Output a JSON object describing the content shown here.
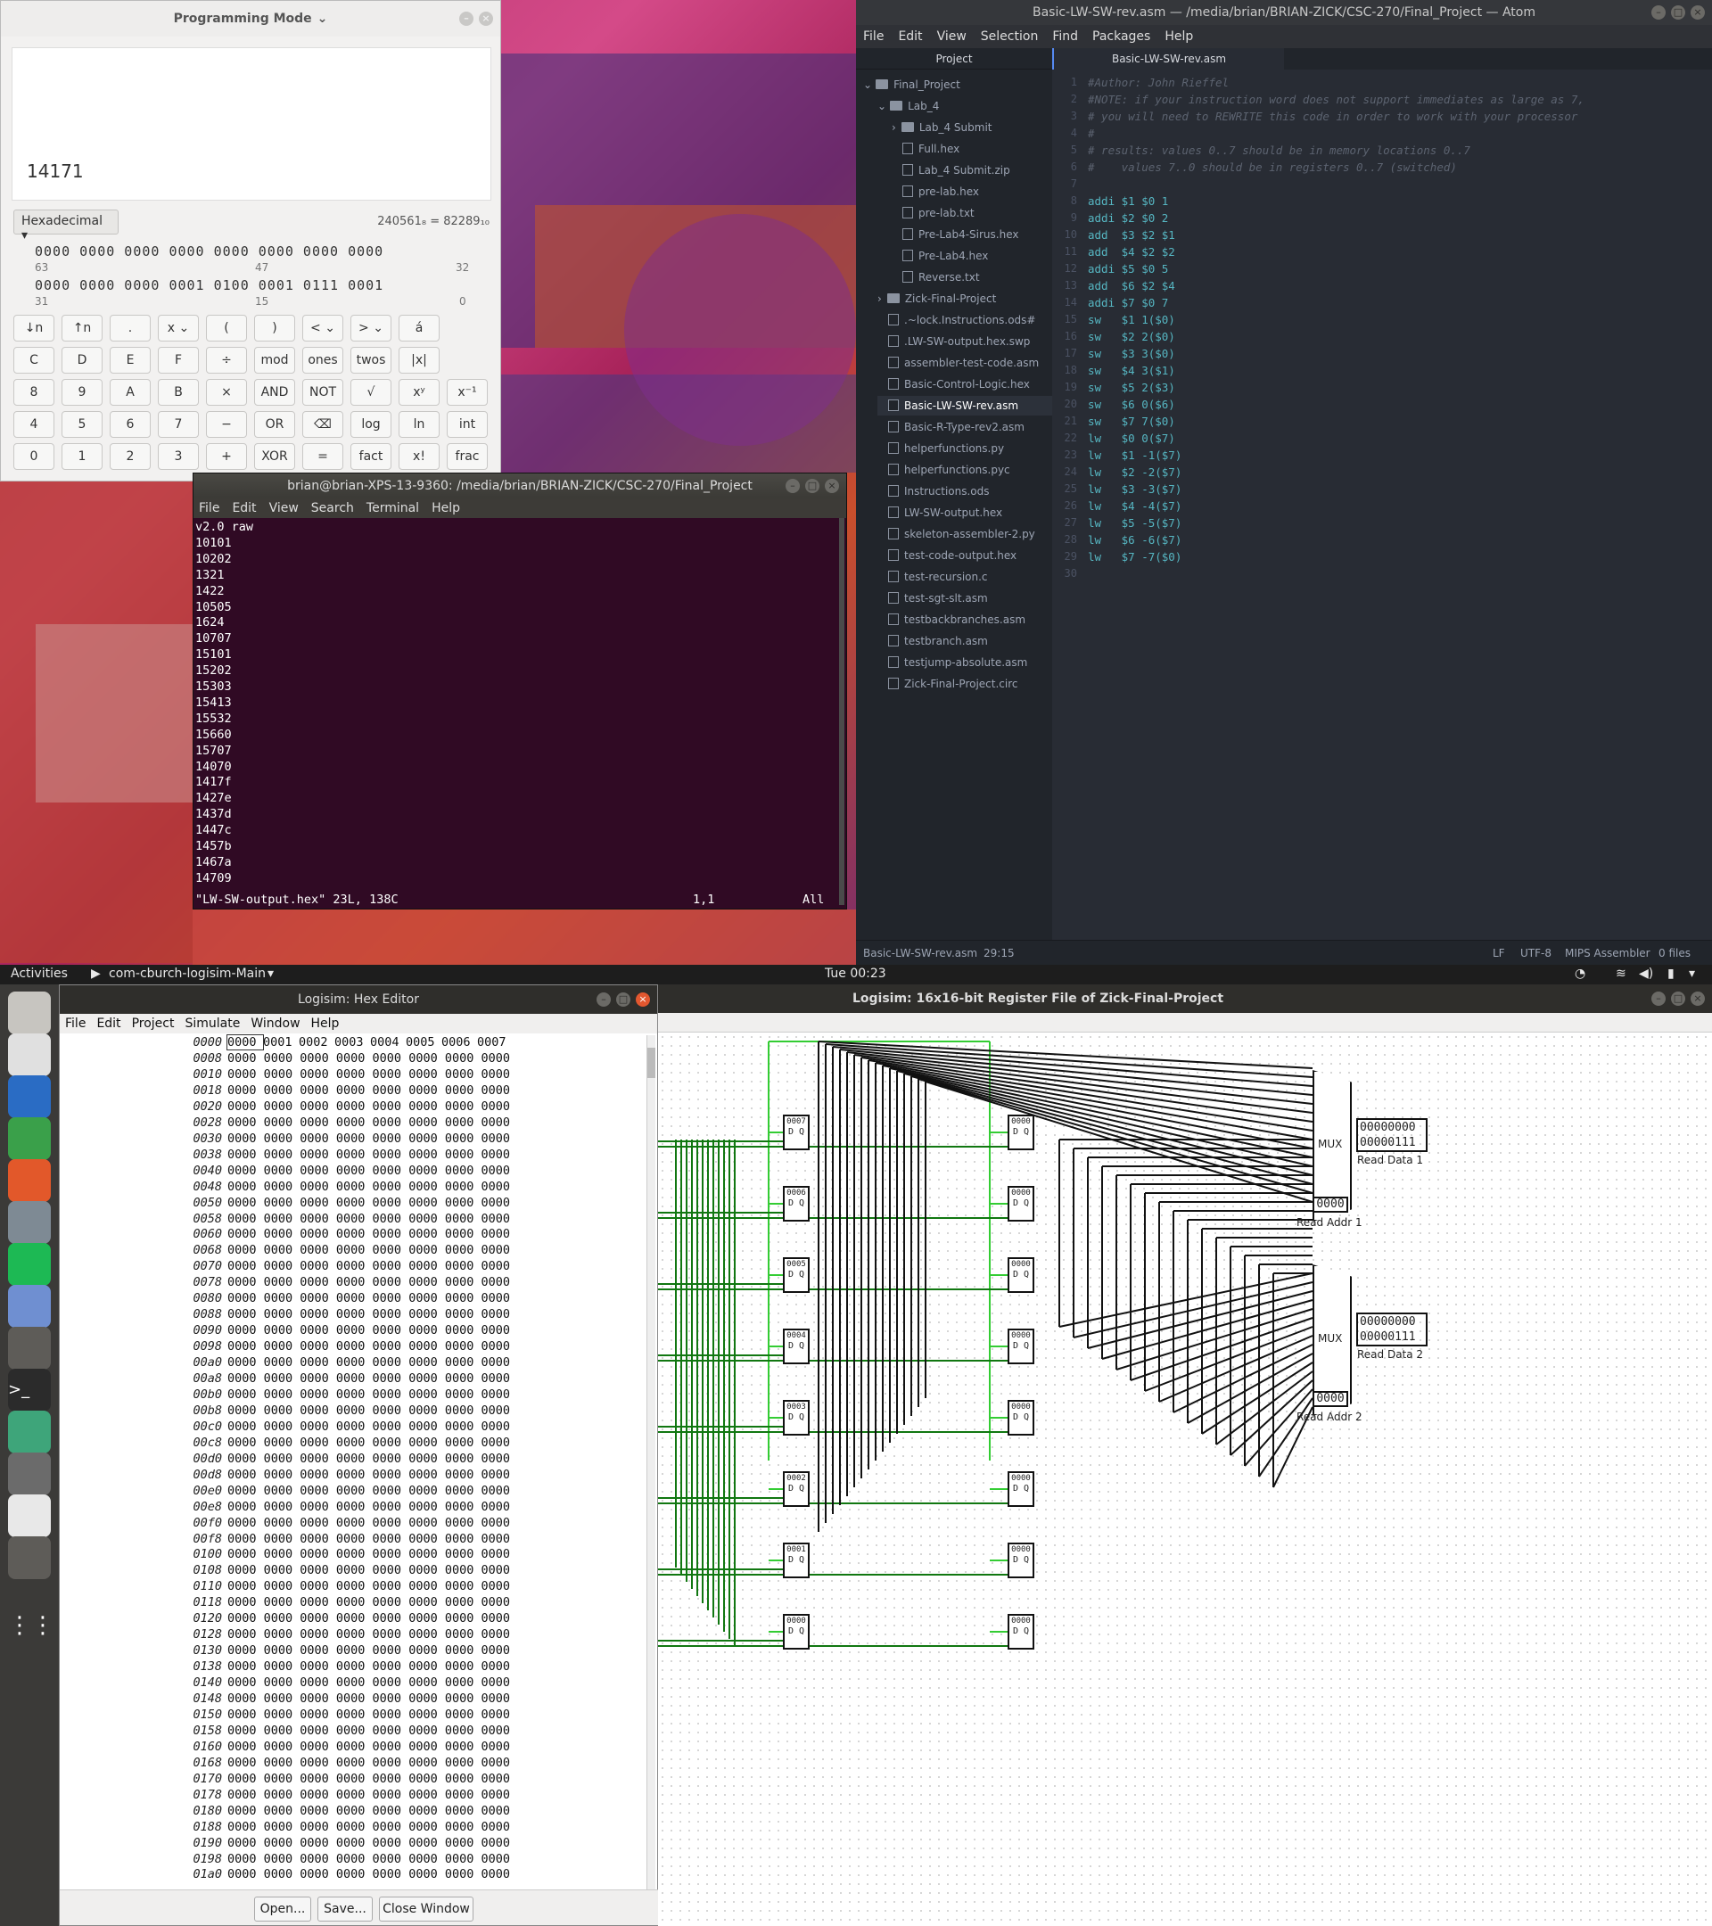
{
  "calculator": {
    "title": "Programming Mode",
    "value": "14171",
    "base": "Hexadecimal",
    "conversion": "240561₈ = 82289₁₀",
    "bits_row1": "0000 0000 0000 0000 0000 0000 0000 0000",
    "bits_row1_idx": [
      "63",
      "47",
      "32"
    ],
    "bits_row2": "0000 0000 0000 0001 0100 0001 0111 0001",
    "bits_row2_idx": [
      "31",
      "15",
      "0"
    ],
    "buttons": [
      [
        "↓n",
        "↑n",
        ".",
        "x ⌄",
        "(",
        ")",
        "< ⌄",
        "> ⌄",
        "á"
      ],
      [
        "C",
        "D",
        "E",
        "F",
        "÷",
        "mod",
        "ones",
        "twos",
        "|x|"
      ],
      [
        "8",
        "9",
        "A",
        "B",
        "×",
        "AND",
        "NOT",
        "√",
        "xʸ",
        "x⁻¹"
      ],
      [
        "4",
        "5",
        "6",
        "7",
        "−",
        "OR",
        "⌫",
        "log",
        "ln",
        "int"
      ],
      [
        "0",
        "1",
        "2",
        "3",
        "+",
        "XOR",
        "=",
        "fact",
        "x!",
        "frac"
      ]
    ]
  },
  "atom": {
    "title": "Basic-LW-SW-rev.asm — /media/brian/BRIAN-ZICK/CSC-270/Final_Project — Atom",
    "menu": [
      "File",
      "Edit",
      "View",
      "Selection",
      "Find",
      "Packages",
      "Help"
    ],
    "project_tab": "Project",
    "file_tab": "Basic-LW-SW-rev.asm",
    "tree": [
      {
        "label": "Final_Project",
        "type": "folder-open",
        "depth": 0
      },
      {
        "label": "Lab_4",
        "type": "folder-open",
        "depth": 1
      },
      {
        "label": "Lab_4 Submit",
        "type": "folder",
        "depth": 2
      },
      {
        "label": "Full.hex",
        "type": "file",
        "depth": 2
      },
      {
        "label": "Lab_4 Submit.zip",
        "type": "file",
        "depth": 2
      },
      {
        "label": "pre-lab.hex",
        "type": "file",
        "depth": 2
      },
      {
        "label": "pre-lab.txt",
        "type": "file",
        "depth": 2
      },
      {
        "label": "Pre-Lab4-Sirus.hex",
        "type": "file",
        "depth": 2
      },
      {
        "label": "Pre-Lab4.hex",
        "type": "file",
        "depth": 2
      },
      {
        "label": "Reverse.txt",
        "type": "file",
        "depth": 2
      },
      {
        "label": "Zick-Final-Project",
        "type": "folder",
        "depth": 1
      },
      {
        "label": ".~lock.Instructions.ods#",
        "type": "file",
        "depth": 1
      },
      {
        "label": ".LW-SW-output.hex.swp",
        "type": "file",
        "depth": 1
      },
      {
        "label": "assembler-test-code.asm",
        "type": "file",
        "depth": 1
      },
      {
        "label": "Basic-Control-Logic.hex",
        "type": "file",
        "depth": 1
      },
      {
        "label": "Basic-LW-SW-rev.asm",
        "type": "file",
        "depth": 1,
        "selected": true
      },
      {
        "label": "Basic-R-Type-rev2.asm",
        "type": "file",
        "depth": 1
      },
      {
        "label": "helperfunctions.py",
        "type": "file",
        "depth": 1
      },
      {
        "label": "helperfunctions.pyc",
        "type": "file",
        "depth": 1
      },
      {
        "label": "Instructions.ods",
        "type": "file",
        "depth": 1
      },
      {
        "label": "LW-SW-output.hex",
        "type": "file",
        "depth": 1
      },
      {
        "label": "skeleton-assembler-2.py",
        "type": "file",
        "depth": 1
      },
      {
        "label": "test-code-output.hex",
        "type": "file",
        "depth": 1
      },
      {
        "label": "test-recursion.c",
        "type": "file",
        "depth": 1
      },
      {
        "label": "test-sgt-slt.asm",
        "type": "file",
        "depth": 1
      },
      {
        "label": "testbackbranches.asm",
        "type": "file",
        "depth": 1
      },
      {
        "label": "testbranch.asm",
        "type": "file",
        "depth": 1
      },
      {
        "label": "testjump-absolute.asm",
        "type": "file",
        "depth": 1
      },
      {
        "label": "Zick-Final-Project.circ",
        "type": "file",
        "depth": 1
      }
    ],
    "code": [
      "#Author: John Rieffel",
      "#NOTE: if your instruction word does not support immediates as large as 7,",
      "# you will need to REWRITE this code in order to work with your processor",
      "#",
      "# results: values 0..7 should be in memory locations 0..7",
      "#    values 7..0 should be in registers 0..7 (switched)",
      "",
      "addi $1 $0 1",
      "addi $2 $0 2",
      "add  $3 $2 $1",
      "add  $4 $2 $2",
      "addi $5 $0 5",
      "add  $6 $2 $4",
      "addi $7 $0 7",
      "sw   $1 1($0)",
      "sw   $2 2($0)",
      "sw   $3 3($0)",
      "sw   $4 3($1)",
      "sw   $5 2($3)",
      "sw   $6 0($6)",
      "sw   $7 7($0)",
      "lw   $0 0($7)",
      "lw   $1 -1($7)",
      "lw   $2 -2($7)",
      "lw   $3 -3($7)",
      "lw   $4 -4($7)",
      "lw   $5 -5($7)",
      "lw   $6 -6($7)",
      "lw   $7 -7($0)",
      ""
    ],
    "status_left": [
      "Basic-LW-SW-rev.asm",
      "29:15"
    ],
    "status_right": [
      "LF",
      "UTF-8",
      "MIPS Assembler",
      "0 files"
    ]
  },
  "terminal": {
    "title": "brian@brian-XPS-13-9360: /media/brian/BRIAN-ZICK/CSC-270/Final_Project",
    "menu": [
      "File",
      "Edit",
      "View",
      "Search",
      "Terminal",
      "Help"
    ],
    "lines": [
      "v2.0 raw",
      "10101",
      "10202",
      "1321",
      "1422",
      "10505",
      "1624",
      "10707",
      "15101",
      "15202",
      "15303",
      "15413",
      "15532",
      "15660",
      "15707",
      "14070",
      "1417f",
      "1427e",
      "1437d",
      "1447c",
      "1457b",
      "1467a",
      "14709"
    ],
    "status_file": "\"LW-SW-output.hex\" 23L, 138C",
    "status_pos": "1,1",
    "status_all": "All"
  },
  "topbar": {
    "activities": "Activities",
    "app": "com-cburch-logisim-Main",
    "clock": "Tue 00:23"
  },
  "dock": [
    "files-icon",
    "chrome-icon",
    "writer-icon",
    "calc-sheet-icon",
    "software-center-icon",
    "settings-icon",
    "spotify-icon",
    "remote-icon",
    "logisim-icon",
    "terminal-icon",
    "atom-icon",
    "calculator-icon",
    "text-editor-icon",
    "logisim-active-icon",
    "app-grid-icon"
  ],
  "hex_editor": {
    "title": "Logisim: Hex Editor",
    "menu": [
      "File",
      "Edit",
      "Project",
      "Simulate",
      "Window",
      "Help"
    ],
    "first_row": {
      "addr": "0000",
      "cells": [
        "0000",
        "0001",
        "0002",
        "0003",
        "0004",
        "0005",
        "0006",
        "0007"
      ]
    },
    "addresses": [
      "0008",
      "0010",
      "0018",
      "0020",
      "0028",
      "0030",
      "0038",
      "0040",
      "0048",
      "0050",
      "0058",
      "0060",
      "0068",
      "0070",
      "0078",
      "0080",
      "0088",
      "0090",
      "0098",
      "00a0",
      "00a8",
      "00b0",
      "00b8",
      "00c0",
      "00c8",
      "00d0",
      "00d8",
      "00e0",
      "00e8",
      "00f0",
      "00f8",
      "0100",
      "0108",
      "0110",
      "0118",
      "0120",
      "0128",
      "0130",
      "0138",
      "0140",
      "0148",
      "0150",
      "0158",
      "0160",
      "0168",
      "0170",
      "0178",
      "0180",
      "0188",
      "0190",
      "0198",
      "01a0"
    ],
    "zero_row": "0000 0000 0000 0000 0000 0000 0000 0000",
    "buttons": [
      "Open...",
      "Save...",
      "Close Window"
    ]
  },
  "logisim": {
    "title": "Logisim: 16x16-bit Register File of Zick-Final-Project",
    "mux_label": "MUX",
    "read_data_1": {
      "label": "Read Data 1",
      "value_hi": "00000000",
      "value_lo": "00000111"
    },
    "read_data_2": {
      "label": "Read Data 2",
      "value_hi": "00000000",
      "value_lo": "00000111"
    },
    "read_addr_1": {
      "label": "Read Addr 1",
      "value": "0000"
    },
    "read_addr_2": {
      "label": "Read Addr 2",
      "value": "0000"
    },
    "registers_left": [
      "0007",
      "0006",
      "0005",
      "0004",
      "0003",
      "0002",
      "0001",
      "0000"
    ],
    "registers_right": [
      "0000",
      "0000",
      "0000",
      "0000",
      "0000",
      "0000",
      "0000",
      "0000"
    ]
  }
}
